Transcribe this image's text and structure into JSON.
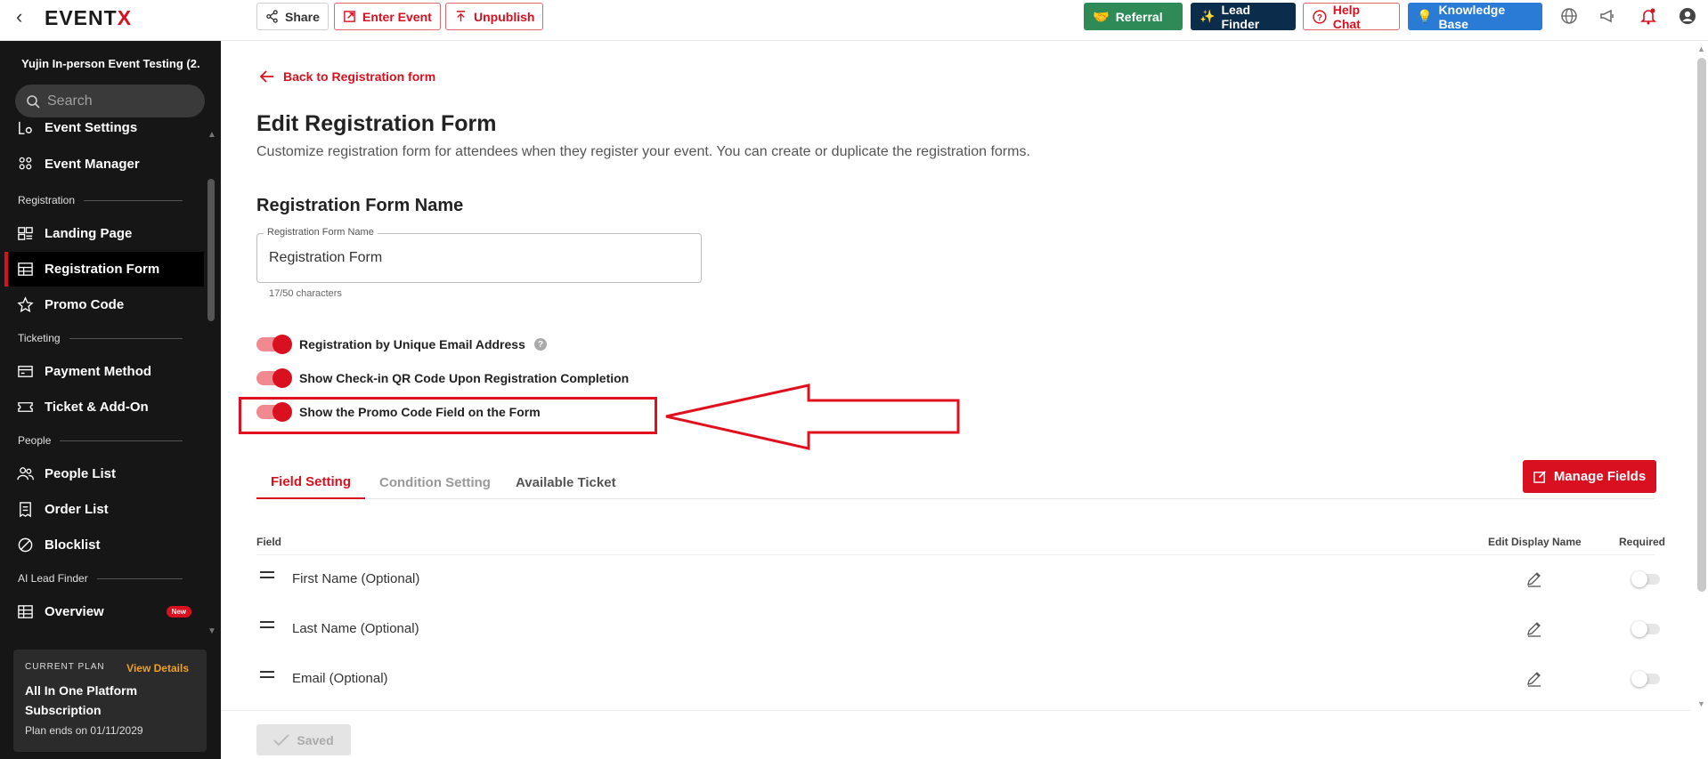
{
  "topbar": {
    "logo_main": "EVENT",
    "logo_x": "X",
    "share_label": "Share",
    "enter_event_label": "Enter Event",
    "unpublish_label": "Unpublish",
    "referral_label": "Referral",
    "lead_finder_label": "Lead Finder",
    "help_chat_label": "Help Chat",
    "knowledge_base_label": "Knowledge Base",
    "colors": {
      "referral": "#2e8b57",
      "lead_finder": "#0b2c4a",
      "knowledge_base": "#2a7bd6",
      "accent": "#d9101f"
    }
  },
  "sidebar": {
    "event_name": "Yujin In-person Event Testing (2...",
    "search_placeholder": "Search",
    "items": {
      "event_settings": "Event Settings",
      "event_manager": "Event Manager",
      "landing_page": "Landing Page",
      "registration_form": "Registration Form",
      "promo_code": "Promo Code",
      "payment_method": "Payment Method",
      "ticket_addon": "Ticket & Add-On",
      "people_list": "People List",
      "order_list": "Order List",
      "blocklist": "Blocklist",
      "overview": "Overview"
    },
    "sections": {
      "registration": "Registration",
      "ticketing": "Ticketing",
      "people": "People",
      "ai_lead_finder": "AI Lead Finder"
    },
    "new_badge": "New",
    "plan": {
      "label": "CURRENT PLAN",
      "view_details": "View Details",
      "name": "All In One Platform Subscription",
      "ends": "Plan ends on 01/11/2029"
    }
  },
  "main": {
    "back_link": "Back to Registration form",
    "title": "Edit Registration Form",
    "subtitle": "Customize registration form for attendees when they register your event. You can create or duplicate the registration forms.",
    "form_name_section": "Registration Form Name",
    "field_label": "Registration Form Name",
    "field_value": "Registration Form",
    "char_count": "17/50 characters",
    "toggles": {
      "unique_email": "Registration by Unique Email Address",
      "qr_code": "Show Check-in QR Code Upon Registration Completion",
      "promo_field": "Show the Promo Code Field on the Form"
    },
    "tabs": {
      "field_setting": "Field Setting",
      "condition_setting": "Condition Setting",
      "available_ticket": "Available Ticket"
    },
    "manage_fields": "Manage Fields",
    "table": {
      "col_field": "Field",
      "col_edit": "Edit Display Name",
      "col_required": "Required",
      "rows": [
        "First Name (Optional)",
        "Last Name (Optional)",
        "Email (Optional)"
      ]
    },
    "saved_label": "Saved"
  }
}
